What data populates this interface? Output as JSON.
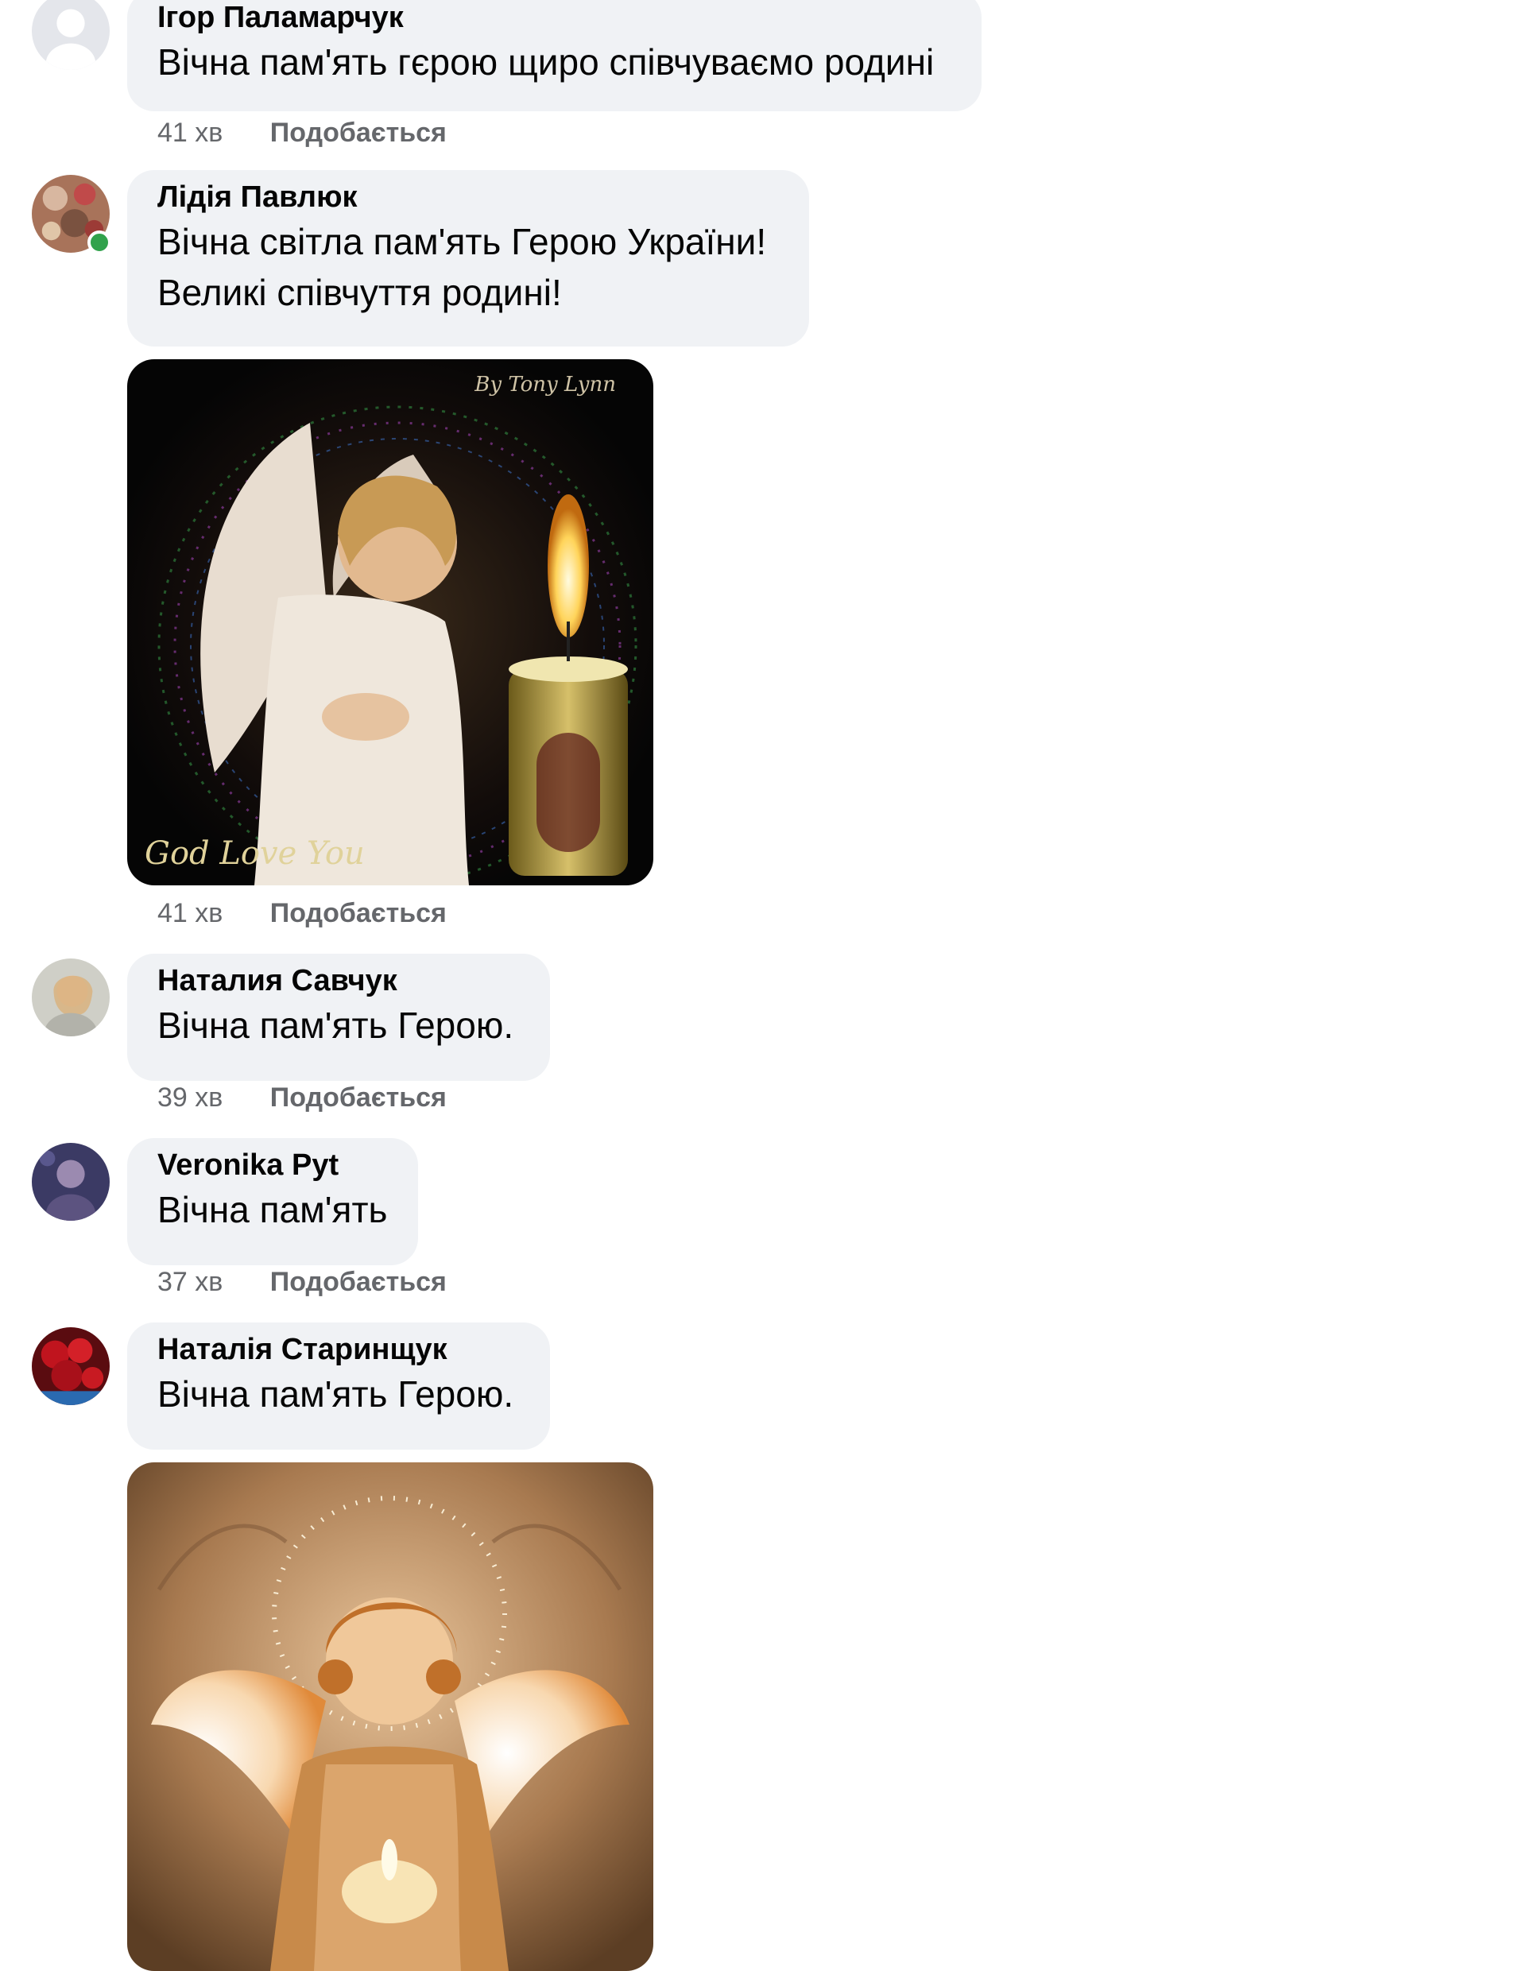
{
  "comments": [
    {
      "author": "Ігор Паламарчук",
      "lines": [
        "Вічна пам'ять гєрою щиро співчуваємо родині"
      ],
      "time": "41 хв",
      "like": "Подобається"
    },
    {
      "author": "Лідія Павлюк",
      "lines": [
        "Вічна світла пам'ять Герою України!",
        "Великі співчуття родині!"
      ],
      "time": "41 хв",
      "like": "Подобається",
      "online": true
    },
    {
      "author": "Наталия Савчук",
      "lines": [
        "Вічна пам'ять Герою."
      ],
      "time": "39 хв",
      "like": "Подобається"
    },
    {
      "author": "Veronika Pyt",
      "lines": [
        "Вічна пам'ять"
      ],
      "time": "37 хв",
      "like": "Подобається"
    },
    {
      "author": "Наталія Старинщук",
      "lines": [
        "Вічна пам'ять Герою."
      ],
      "time": "",
      "like": ""
    }
  ],
  "attachments": {
    "angel_candle_gif": {
      "signature_top": "By Tony Lynn",
      "signature_bottom": "God Love You"
    },
    "child_angel_gif": {}
  },
  "colors": {
    "bubble": "#f0f2f5",
    "meta": "#65676b",
    "online": "#31a24c"
  }
}
